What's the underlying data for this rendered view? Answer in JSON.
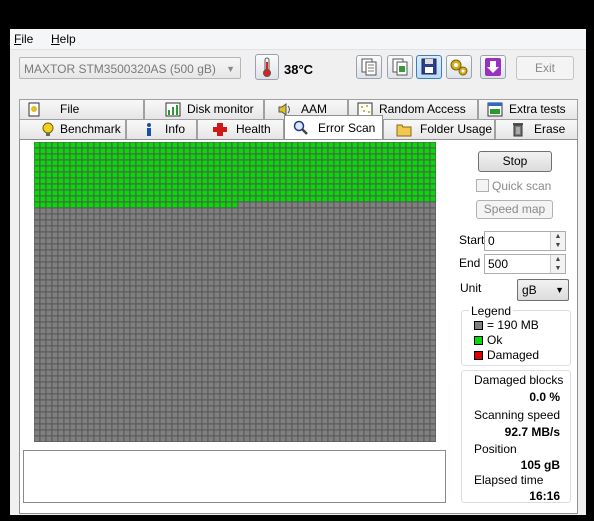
{
  "menu": {
    "file": "File",
    "file_key": "F",
    "file_rest": "ile",
    "help": "Help",
    "help_key": "H",
    "help_rest": "elp"
  },
  "toolbar": {
    "drive": "MAXTOR STM3500320AS (500 gB)",
    "temperature": "38°C",
    "exit_label": "Exit"
  },
  "tabs": {
    "row_top": [
      "File Benchmark",
      "Disk monitor",
      "AAM",
      "Random Access",
      "Extra tests"
    ],
    "row_bottom": [
      "Benchmark",
      "Info",
      "Health",
      "Error Scan",
      "Folder Usage",
      "Erase"
    ],
    "active": "Error Scan"
  },
  "scan": {
    "stop_label": "Stop",
    "quick_scan_label": "Quick scan",
    "quick_scan_checked": false,
    "speed_map_label": "Speed map",
    "start_label": "Start",
    "start_value": "0",
    "end_label": "End",
    "end_value": "500",
    "unit_label": "Unit",
    "unit_value": "gB"
  },
  "legend": {
    "title": "Legend",
    "block_size": "= 190 MB",
    "ok": "Ok",
    "damaged": "Damaged",
    "colors": {
      "block": "#808080",
      "ok": "#00dd00",
      "damaged": "#dd0000"
    }
  },
  "stats": {
    "damaged_blocks_label": "Damaged blocks",
    "damaged_blocks_value": "0.0 %",
    "scanning_speed_label": "Scanning speed",
    "scanning_speed_value": "92.7 MB/s",
    "position_label": "Position",
    "position_value": "105 gB",
    "elapsed_label": "Elapsed time",
    "elapsed_value": "16:16"
  },
  "grid": {
    "columns": 67,
    "rows": 50,
    "scanned_fraction": 0.21,
    "scanned_color": "#00dd00",
    "unscanned_color": "#808080"
  }
}
